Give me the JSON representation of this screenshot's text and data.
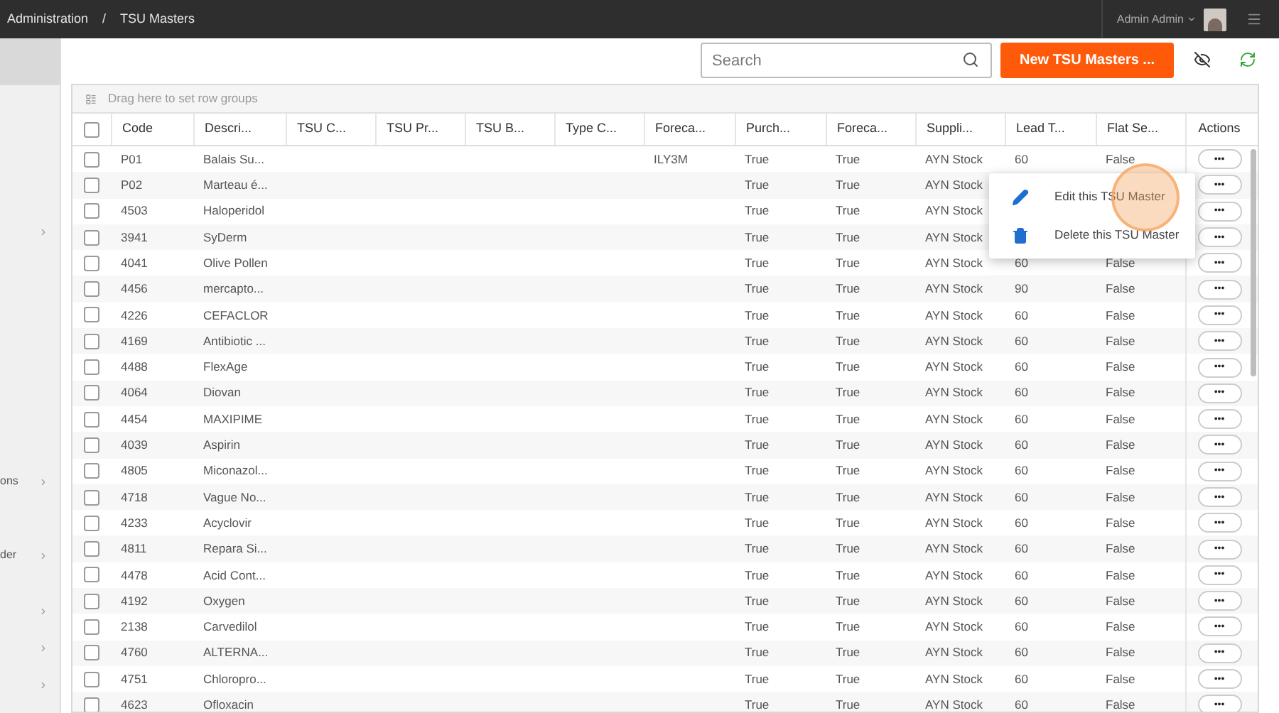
{
  "breadcrumb": [
    "Administration",
    "/",
    "TSU Masters"
  ],
  "user": {
    "name": "Admin Admin"
  },
  "sidebar": {
    "items": [
      {
        "selected": true,
        "expandable": false
      },
      {
        "selected": false,
        "expandable": true
      },
      {
        "label": "ons",
        "selected": false,
        "expandable": true
      },
      {
        "label": "der",
        "selected": false,
        "expandable": true
      },
      {
        "selected": false,
        "expandable": true
      },
      {
        "selected": false,
        "expandable": true
      },
      {
        "selected": false,
        "expandable": true
      }
    ]
  },
  "search": {
    "placeholder": "Search"
  },
  "new_button": "New TSU Masters ...",
  "group_panel": "Drag here to set row groups",
  "table": {
    "select_all_checked": false,
    "columns": [
      "Code",
      "Descri...",
      "TSU C...",
      "TSU Pr...",
      "TSU B...",
      "Type C...",
      "Foreca...",
      "Purch...",
      "Foreca...",
      "Suppli...",
      "Lead T...",
      "Flat Se...",
      "Actions"
    ],
    "rows": [
      {
        "checked": false,
        "code": "P01",
        "description": "Balais Su...",
        "forecast_code": "ILY3M",
        "purchase": "True",
        "forecast": "True",
        "supplier": "AYN Stock",
        "lead_time": "60",
        "flat": "False",
        "action": "•••"
      },
      {
        "checked": false,
        "code": "P02",
        "description": "Marteau é...",
        "purchase": "True",
        "forecast": "True",
        "supplier": "AYN Stock",
        "action": "•••"
      },
      {
        "checked": false,
        "code": "4503",
        "description": "Haloperidol",
        "purchase": "True",
        "forecast": "True",
        "supplier": "AYN Stock",
        "action": "•••"
      },
      {
        "checked": false,
        "code": "3941",
        "description": "SyDerm",
        "purchase": "True",
        "forecast": "True",
        "supplier": "AYN Stock",
        "action": "•••"
      },
      {
        "checked": false,
        "code": "4041",
        "description": "Olive Pollen",
        "purchase": "True",
        "forecast": "True",
        "supplier": "AYN Stock",
        "lead_time": "60",
        "flat": "False",
        "action": "•••"
      },
      {
        "checked": false,
        "code": "4456",
        "description": "mercapto...",
        "purchase": "True",
        "forecast": "True",
        "supplier": "AYN Stock",
        "lead_time": "90",
        "flat": "False",
        "action": "•••"
      },
      {
        "checked": false,
        "code": "4226",
        "description": "CEFACLOR",
        "purchase": "True",
        "forecast": "True",
        "supplier": "AYN Stock",
        "lead_time": "60",
        "flat": "False",
        "action": "•••"
      },
      {
        "checked": false,
        "code": "4169",
        "description": "Antibiotic ...",
        "purchase": "True",
        "forecast": "True",
        "supplier": "AYN Stock",
        "lead_time": "60",
        "flat": "False",
        "action": "•••"
      },
      {
        "checked": false,
        "code": "4488",
        "description": "FlexAge",
        "purchase": "True",
        "forecast": "True",
        "supplier": "AYN Stock",
        "lead_time": "60",
        "flat": "False",
        "action": "•••"
      },
      {
        "checked": false,
        "code": "4064",
        "description": "Diovan",
        "purchase": "True",
        "forecast": "True",
        "supplier": "AYN Stock",
        "lead_time": "60",
        "flat": "False",
        "action": "•••"
      },
      {
        "checked": false,
        "code": "4454",
        "description": "MAXIPIME",
        "purchase": "True",
        "forecast": "True",
        "supplier": "AYN Stock",
        "lead_time": "60",
        "flat": "False",
        "action": "•••"
      },
      {
        "checked": false,
        "code": "4039",
        "description": "Aspirin",
        "purchase": "True",
        "forecast": "True",
        "supplier": "AYN Stock",
        "lead_time": "60",
        "flat": "False",
        "action": "•••"
      },
      {
        "checked": false,
        "code": "4805",
        "description": "Miconazol...",
        "purchase": "True",
        "forecast": "True",
        "supplier": "AYN Stock",
        "lead_time": "60",
        "flat": "False",
        "action": "•••"
      },
      {
        "checked": false,
        "code": "4718",
        "description": "Vague No...",
        "purchase": "True",
        "forecast": "True",
        "supplier": "AYN Stock",
        "lead_time": "60",
        "flat": "False",
        "action": "•••"
      },
      {
        "checked": false,
        "code": "4233",
        "description": "Acyclovir",
        "purchase": "True",
        "forecast": "True",
        "supplier": "AYN Stock",
        "lead_time": "60",
        "flat": "False",
        "action": "•••"
      },
      {
        "checked": false,
        "code": "4811",
        "description": "Repara Si...",
        "purchase": "True",
        "forecast": "True",
        "supplier": "AYN Stock",
        "lead_time": "60",
        "flat": "False",
        "action": "•••"
      },
      {
        "checked": false,
        "code": "4478",
        "description": "Acid Cont...",
        "purchase": "True",
        "forecast": "True",
        "supplier": "AYN Stock",
        "lead_time": "60",
        "flat": "False",
        "action": "•••"
      },
      {
        "checked": false,
        "code": "4192",
        "description": "Oxygen",
        "purchase": "True",
        "forecast": "True",
        "supplier": "AYN Stock",
        "lead_time": "60",
        "flat": "False",
        "action": "•••"
      },
      {
        "checked": false,
        "code": "2138",
        "description": "Carvedilol",
        "purchase": "True",
        "forecast": "True",
        "supplier": "AYN Stock",
        "lead_time": "60",
        "flat": "False",
        "action": "•••"
      },
      {
        "checked": false,
        "code": "4760",
        "description": "ALTERNA...",
        "purchase": "True",
        "forecast": "True",
        "supplier": "AYN Stock",
        "lead_time": "60",
        "flat": "False",
        "action": "•••"
      },
      {
        "checked": false,
        "code": "4751",
        "description": "Chloropro...",
        "purchase": "True",
        "forecast": "True",
        "supplier": "AYN Stock",
        "lead_time": "60",
        "flat": "False",
        "action": "•••"
      },
      {
        "checked": false,
        "code": "4623",
        "description": "Ofloxacin",
        "purchase": "True",
        "forecast": "True",
        "supplier": "AYN Stock",
        "lead_time": "60",
        "flat": "False",
        "action": "•••"
      }
    ]
  },
  "context_menu": {
    "items": [
      {
        "kind": "edit",
        "label": "Edit this TSU Master"
      },
      {
        "kind": "delete",
        "label": "Delete this TSU Master"
      }
    ]
  }
}
